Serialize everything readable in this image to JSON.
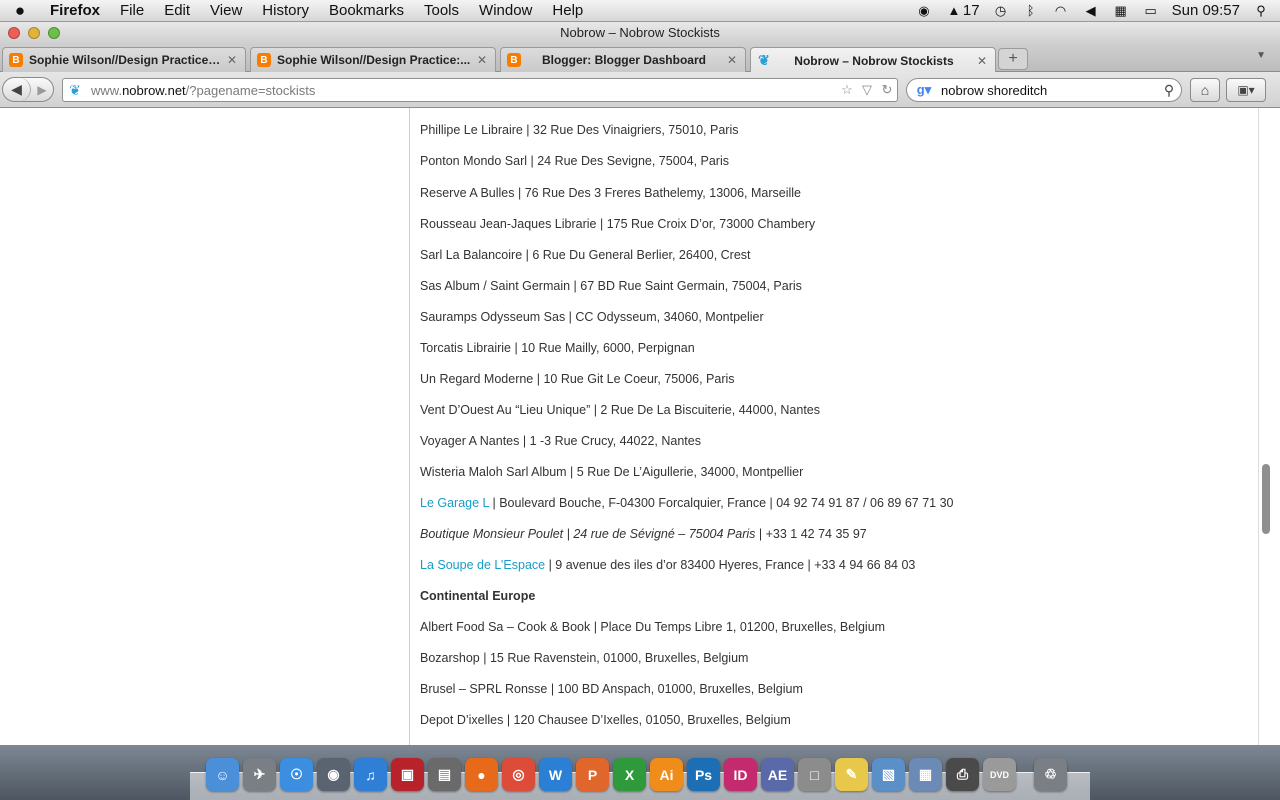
{
  "menubar": {
    "app_name": "Firefox",
    "items": [
      "File",
      "Edit",
      "View",
      "History",
      "Bookmarks",
      "Tools",
      "Window",
      "Help"
    ],
    "status": {
      "battery_text": "17",
      "clock": "Sun 09:57"
    }
  },
  "window": {
    "title": "Nobrow – Nobrow Stockists"
  },
  "tabs": [
    {
      "label": "Sophie Wilson//Design Practice:...",
      "favicon": "blogger-icon",
      "active": false
    },
    {
      "label": "Sophie Wilson//Design Practice:...",
      "favicon": "blogger-icon",
      "active": false
    },
    {
      "label": "Blogger: Blogger Dashboard",
      "favicon": "blogger-icon",
      "active": false
    },
    {
      "label": "Nobrow – Nobrow Stockists",
      "favicon": "bird-icon",
      "active": true
    }
  ],
  "toolbar": {
    "url_prefix": "www.",
    "url_host": "nobrow.net",
    "url_path": "/?pagename=stockists",
    "search_value": "nobrow shoreditch"
  },
  "stockists": [
    {
      "text": "Phillipe Le Libraire | 32 Rue Des Vinaigriers, 75010, Paris"
    },
    {
      "text": "Ponton Mondo Sarl | 24 Rue Des Sevigne, 75004, Paris"
    },
    {
      "text": "Reserve A Bulles | 76 Rue Des 3 Freres Bathelemy, 13006, Marseille"
    },
    {
      "text": "Rousseau Jean-Jaques Librarie | 175 Rue Croix D’or, 73000 Chambery"
    },
    {
      "text": "Sarl La Balancoire | 6 Rue Du General Berlier, 26400, Crest"
    },
    {
      "text": "Sas Album / Saint Germain | 67 BD Rue Saint Germain, 75004, Paris"
    },
    {
      "text": "Sauramps Odysseum Sas | CC Odysseum, 34060, Montpelier"
    },
    {
      "text": "Torcatis Librairie | 10 Rue Mailly, 6000, Perpignan"
    },
    {
      "text": "Un Regard Moderne | 10 Rue Git Le Coeur, 75006, Paris"
    },
    {
      "text": "Vent D’Ouest Au “Lieu Unique” | 2 Rue De La Biscuiterie, 44000, Nantes"
    },
    {
      "text": "Voyager A Nantes | 1 -3 Rue Crucy, 44022, Nantes"
    },
    {
      "text": "Wisteria Maloh Sarl Album | 5 Rue De L’Aigullerie, 34000, Montpellier"
    }
  ],
  "linked_stockists": {
    "garage_link": "Le Garage L",
    "garage_rest": " | Boulevard Bouche, F-04300 Forcalquier, France | 04 92 74 91 87 / 06 89 67 71 30",
    "poulet_italic": "Boutique Monsieur Poulet | 24 rue de Sévigné – 75004 Paris",
    "poulet_rest": " | +33 1 42 74 35 97",
    "soupe_link": "La Soupe de L’Espace",
    "soupe_rest": " | 9 avenue des iles d’or 83400 Hyeres, France | +33 4 94 66 84 03"
  },
  "section_heading": "Continental Europe",
  "europe_stockists": [
    {
      "text": "Albert Food Sa – Cook & Book | Place Du Temps Libre 1, 01200, Bruxelles, Belgium"
    },
    {
      "text": "Bozarshop | 15 Rue Ravenstein, 01000, Bruxelles, Belgium"
    },
    {
      "text": "Brusel – SPRL Ronsse | 100 BD Anspach, 01000, Bruxelles, Belgium"
    },
    {
      "text": "Depot D’ixelles | 120 Chausee D’Ixelles, 01050, Bruxelles, Belgium"
    }
  ],
  "dock": [
    {
      "name": "finder-icon",
      "glyph": "☺",
      "color": "#4a8fd8"
    },
    {
      "name": "launchpad-icon",
      "glyph": "✈",
      "color": "#7a7f86"
    },
    {
      "name": "safari-icon",
      "glyph": "☉",
      "color": "#3b8ee0"
    },
    {
      "name": "facetime-icon",
      "glyph": "◉",
      "color": "#5a6470"
    },
    {
      "name": "itunes-icon",
      "glyph": "♫",
      "color": "#2f7fd6"
    },
    {
      "name": "photo-booth-icon",
      "glyph": "▣",
      "color": "#b8232b"
    },
    {
      "name": "iphoto-icon",
      "glyph": "▤",
      "color": "#6a6a6a"
    },
    {
      "name": "firefox-icon",
      "glyph": "●",
      "color": "#e66a1a"
    },
    {
      "name": "chrome-icon",
      "glyph": "◎",
      "color": "#dd4b39"
    },
    {
      "name": "word-icon",
      "glyph": "W",
      "color": "#2b7fd4"
    },
    {
      "name": "powerpoint-icon",
      "glyph": "P",
      "color": "#e0662b"
    },
    {
      "name": "excel-icon",
      "glyph": "X",
      "color": "#2e9a3c"
    },
    {
      "name": "illustrator-icon",
      "glyph": "Ai",
      "color": "#f08c1a"
    },
    {
      "name": "photoshop-icon",
      "glyph": "Ps",
      "color": "#1d6fb5"
    },
    {
      "name": "indesign-icon",
      "glyph": "ID",
      "color": "#c42a6e"
    },
    {
      "name": "after-effects-icon",
      "glyph": "AE",
      "color": "#5a6aa8"
    },
    {
      "name": "camera-icon",
      "glyph": "□",
      "color": "#8c8c8c"
    },
    {
      "name": "stickies-icon",
      "glyph": "✎",
      "color": "#e8c84a"
    },
    {
      "name": "preview-icon",
      "glyph": "▧",
      "color": "#5b8fc7"
    },
    {
      "name": "image-capture-icon",
      "glyph": "▦",
      "color": "#6b8ab5"
    },
    {
      "name": "printer-icon",
      "glyph": "⎙",
      "color": "#4a4a4a"
    },
    {
      "name": "dvd-player-icon",
      "glyph": "DVD",
      "color": "#9a9a9a"
    },
    {
      "name": "trash-icon",
      "glyph": "♲",
      "color": "#7a7f86"
    }
  ]
}
